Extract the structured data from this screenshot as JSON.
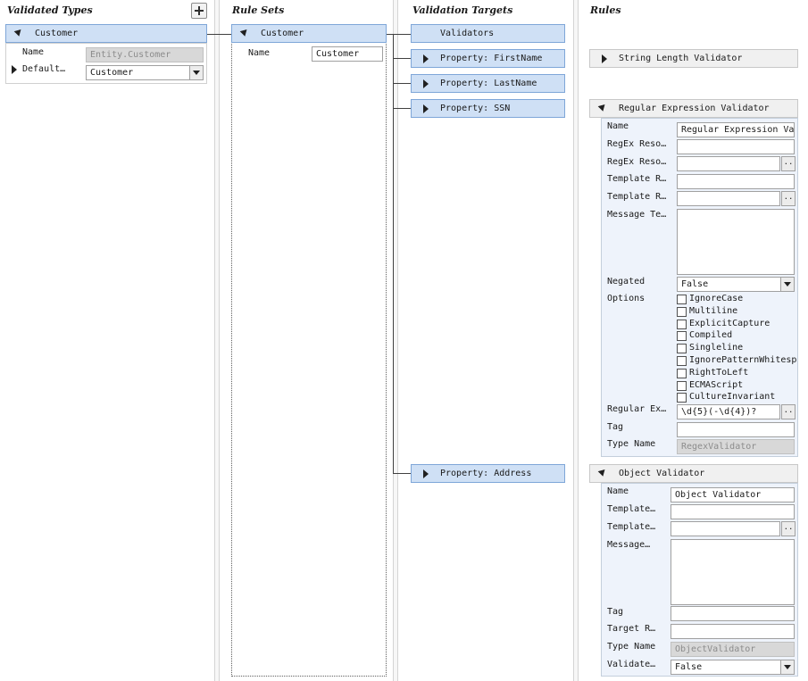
{
  "headers": {
    "validated_types": "Validated Types",
    "rule_sets": "Rule Sets",
    "validation_targets": "Validation Targets",
    "rules": "Rules"
  },
  "validated_type": {
    "title": "Customer",
    "name_label": "Name",
    "name_value": "Entity.Customer",
    "default_label": "Default…",
    "default_value": "Customer"
  },
  "rule_set": {
    "title": "Customer",
    "name_label": "Name",
    "name_value": "Customer"
  },
  "targets": {
    "validators": "Validators",
    "first_name": "Property: FirstName",
    "last_name": "Property: LastName",
    "ssn": "Property: SSN",
    "address": "Property: Address"
  },
  "string_length_validator": {
    "title": "String Length Validator"
  },
  "regex_validator": {
    "title": "Regular Expression Validator",
    "name_label": "Name",
    "name_value": "Regular Expression Va",
    "regex_res1_label": "RegEx Reso…",
    "regex_res2_label": "RegEx Reso…",
    "template1_label": "Template R…",
    "template2_label": "Template R…",
    "message_label": "Message Te…",
    "negated_label": "Negated",
    "negated_value": "False",
    "options_label": "Options",
    "options": [
      "IgnoreCase",
      "Multiline",
      "ExplicitCapture",
      "Compiled",
      "Singleline",
      "IgnorePatternWhitesp",
      "RightToLeft",
      "ECMAScript",
      "CultureInvariant"
    ],
    "regex_label": "Regular Ex…",
    "regex_value": "\\d{5}(-\\d{4})?",
    "tag_label": "Tag",
    "type_name_label": "Type Name",
    "type_name_value": "RegexValidator",
    "ellipsis": ".."
  },
  "object_validator": {
    "title": "Object Validator",
    "name_label": "Name",
    "name_value": "Object Validator",
    "template1_label": "Template…",
    "template2_label": "Template…",
    "message_label": "Message…",
    "tag_label": "Tag",
    "target_label": "Target R…",
    "type_name_label": "Type Name",
    "type_name_value": "ObjectValidator",
    "validate_label": "Validate…",
    "validate_value": "False",
    "ellipsis": ".."
  },
  "icons": {
    "add": "add-icon",
    "expanded": "triangle-down-icon",
    "collapsed": "triangle-right-icon",
    "dropdown": "chevron-down-icon"
  }
}
